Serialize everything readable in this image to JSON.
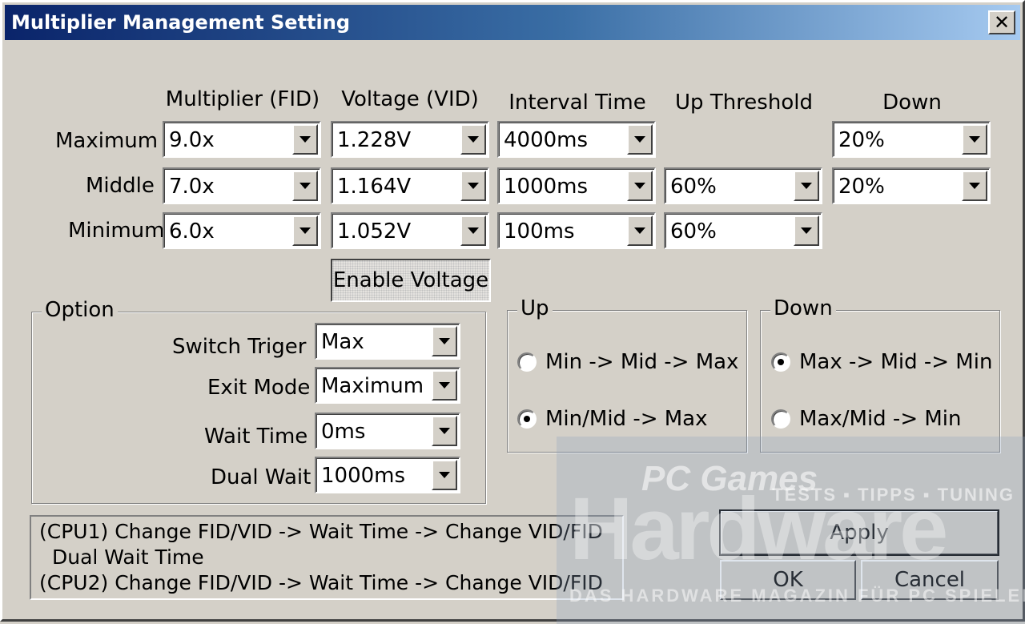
{
  "window": {
    "title": "Multiplier Management Setting",
    "close_label": "✕"
  },
  "headers": {
    "multiplier": "Multiplier (FID)",
    "voltage": "Voltage (VID)",
    "interval": "Interval Time",
    "up_threshold": "Up Threshold",
    "down": "Down"
  },
  "rows": {
    "maximum": {
      "label": "Maximum",
      "multiplier": "9.0x",
      "voltage": "1.228V",
      "interval": "4000ms",
      "down": "20%"
    },
    "middle": {
      "label": "Middle",
      "multiplier": "7.0x",
      "voltage": "1.164V",
      "interval": "1000ms",
      "up_threshold": "60%",
      "down": "20%"
    },
    "minimum": {
      "label": "Minimum",
      "multiplier": "6.0x",
      "voltage": "1.052V",
      "interval": "100ms",
      "up_threshold": "60%"
    }
  },
  "enable_voltage_label": "Enable Voltage",
  "option": {
    "legend": "Option",
    "switch_trigger": {
      "label": "Switch Triger",
      "value": "Max"
    },
    "exit_mode": {
      "label": "Exit Mode",
      "value": "Maximum"
    },
    "wait_time": {
      "label": "Wait Time",
      "value": "0ms"
    },
    "dual_wait": {
      "label": "Dual Wait",
      "value": "1000ms"
    }
  },
  "up_group": {
    "legend": "Up",
    "opt1": "Min -> Mid -> Max",
    "opt2": "Min/Mid -> Max",
    "selected": "opt2"
  },
  "down_group": {
    "legend": "Down",
    "opt1": "Max -> Mid -> Min",
    "opt2": "Max/Mid -> Min",
    "selected": "opt1"
  },
  "info": {
    "line1": "(CPU1) Change FID/VID -> Wait Time -> Change VID/FID",
    "line2": "Dual Wait Time",
    "line3": "(CPU2) Change FID/VID -> Wait Time -> Change VID/FID"
  },
  "buttons": {
    "apply": "Apply",
    "ok": "OK",
    "cancel": "Cancel"
  },
  "watermark": {
    "games": "PC Games",
    "brand": "Hardware",
    "tagline": "TESTS ▪ TIPPS ▪ TUNING",
    "subtitle": "DAS HARDWARE MAGAZIN FÜR PC SPIELER"
  },
  "colors": {
    "face": "#d4d0c8",
    "title_start": "#0a246a",
    "title_end": "#a6caf0"
  }
}
